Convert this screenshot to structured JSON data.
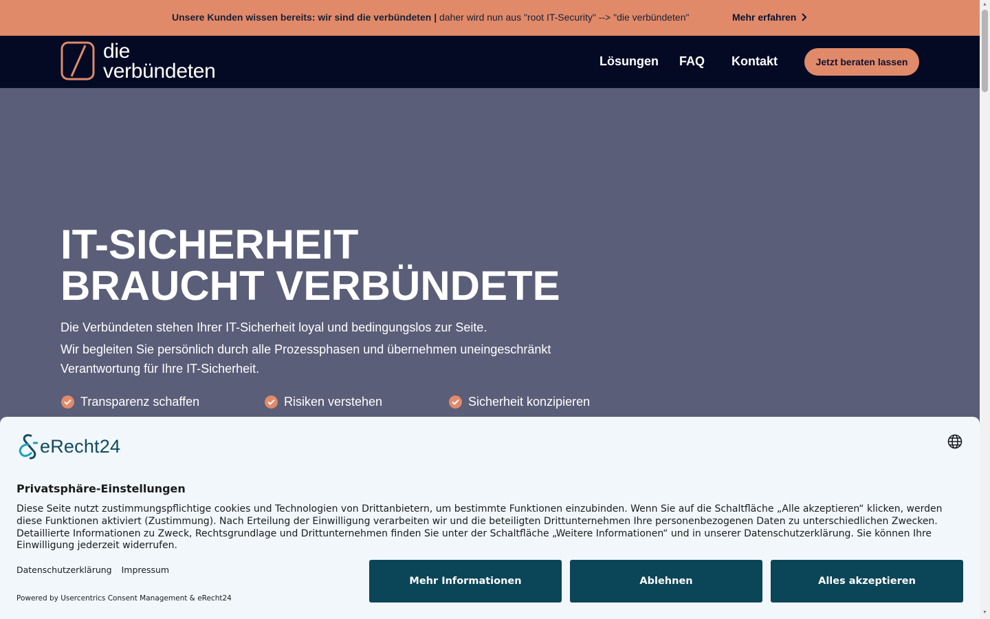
{
  "announcement": {
    "bold_text": "Unsere Kunden wissen bereits: wir sind die verbündeten |",
    "normal_text": " daher wird nun aus \"root IT-Security\" --> \"die verbündeten\"",
    "link_label": "Mehr erfahren"
  },
  "header": {
    "logo_line1": "die",
    "logo_line2": "verbündeten",
    "nav": [
      "Lösungen",
      "FAQ",
      "Kontakt"
    ],
    "cta_label": "Jetzt beraten lassen"
  },
  "hero": {
    "title_line1": "IT-SICHERHEIT",
    "title_line2": "BRAUCHT VERBÜNDETE",
    "subtitle1": "Die Verbündeten stehen Ihrer IT-Sicherheit loyal und bedingungslos zur Seite.",
    "subtitle2": "Wir begleiten Sie persönlich durch alle Prozessphasen und  übernehmen uneingeschränkt Verantwortung für Ihre IT-Sicherheit.",
    "checks": [
      "Transparenz schaffen",
      "Risiken verstehen",
      "Sicherheit konzipieren"
    ]
  },
  "consent": {
    "brand_name": "eRecht24",
    "title": "Privatsphäre-Einstellungen",
    "text": "Diese Seite nutzt zustimmungspflichtige cookies und Technologien von Drittanbietern, um bestimmte Funktionen einzubinden. Wenn Sie auf die Schaltfläche „Alle akzeptieren“ klicken, werden diese Funktionen aktiviert (Zustimmung). Nach Erteilung der Einwilligung verarbeiten wir und die beteiligten Drittunternehmen Ihre personenbezogenen Daten zu unterschiedlichen Zwecken. Detaillierte Informationen zu Zweck, Rechtsgrundlage und Drittunternehmen finden Sie unter der Schaltfläche „Weitere Informationen“ und in unserer Datenschutzerklärung. Sie können Ihre Einwilligung jederzeit widerrufen.",
    "links": [
      "Datenschutzerklärung",
      "Impressum"
    ],
    "powered": "Powered by Usercentrics Consent Management & eRecht24",
    "buttons": {
      "more": "Mehr Informationen",
      "decline": "Ablehnen",
      "accept": "Alles akzeptieren"
    }
  },
  "colors": {
    "accent": "#e08a6a",
    "header_bg": "#050a24",
    "hero_bg": "#5a5e78",
    "consent_button": "#0b4558"
  },
  "icons": [
    "chevron-right-icon",
    "logo-icon",
    "check-circle-icon",
    "globe-icon",
    "erecht24-logo-icon"
  ]
}
